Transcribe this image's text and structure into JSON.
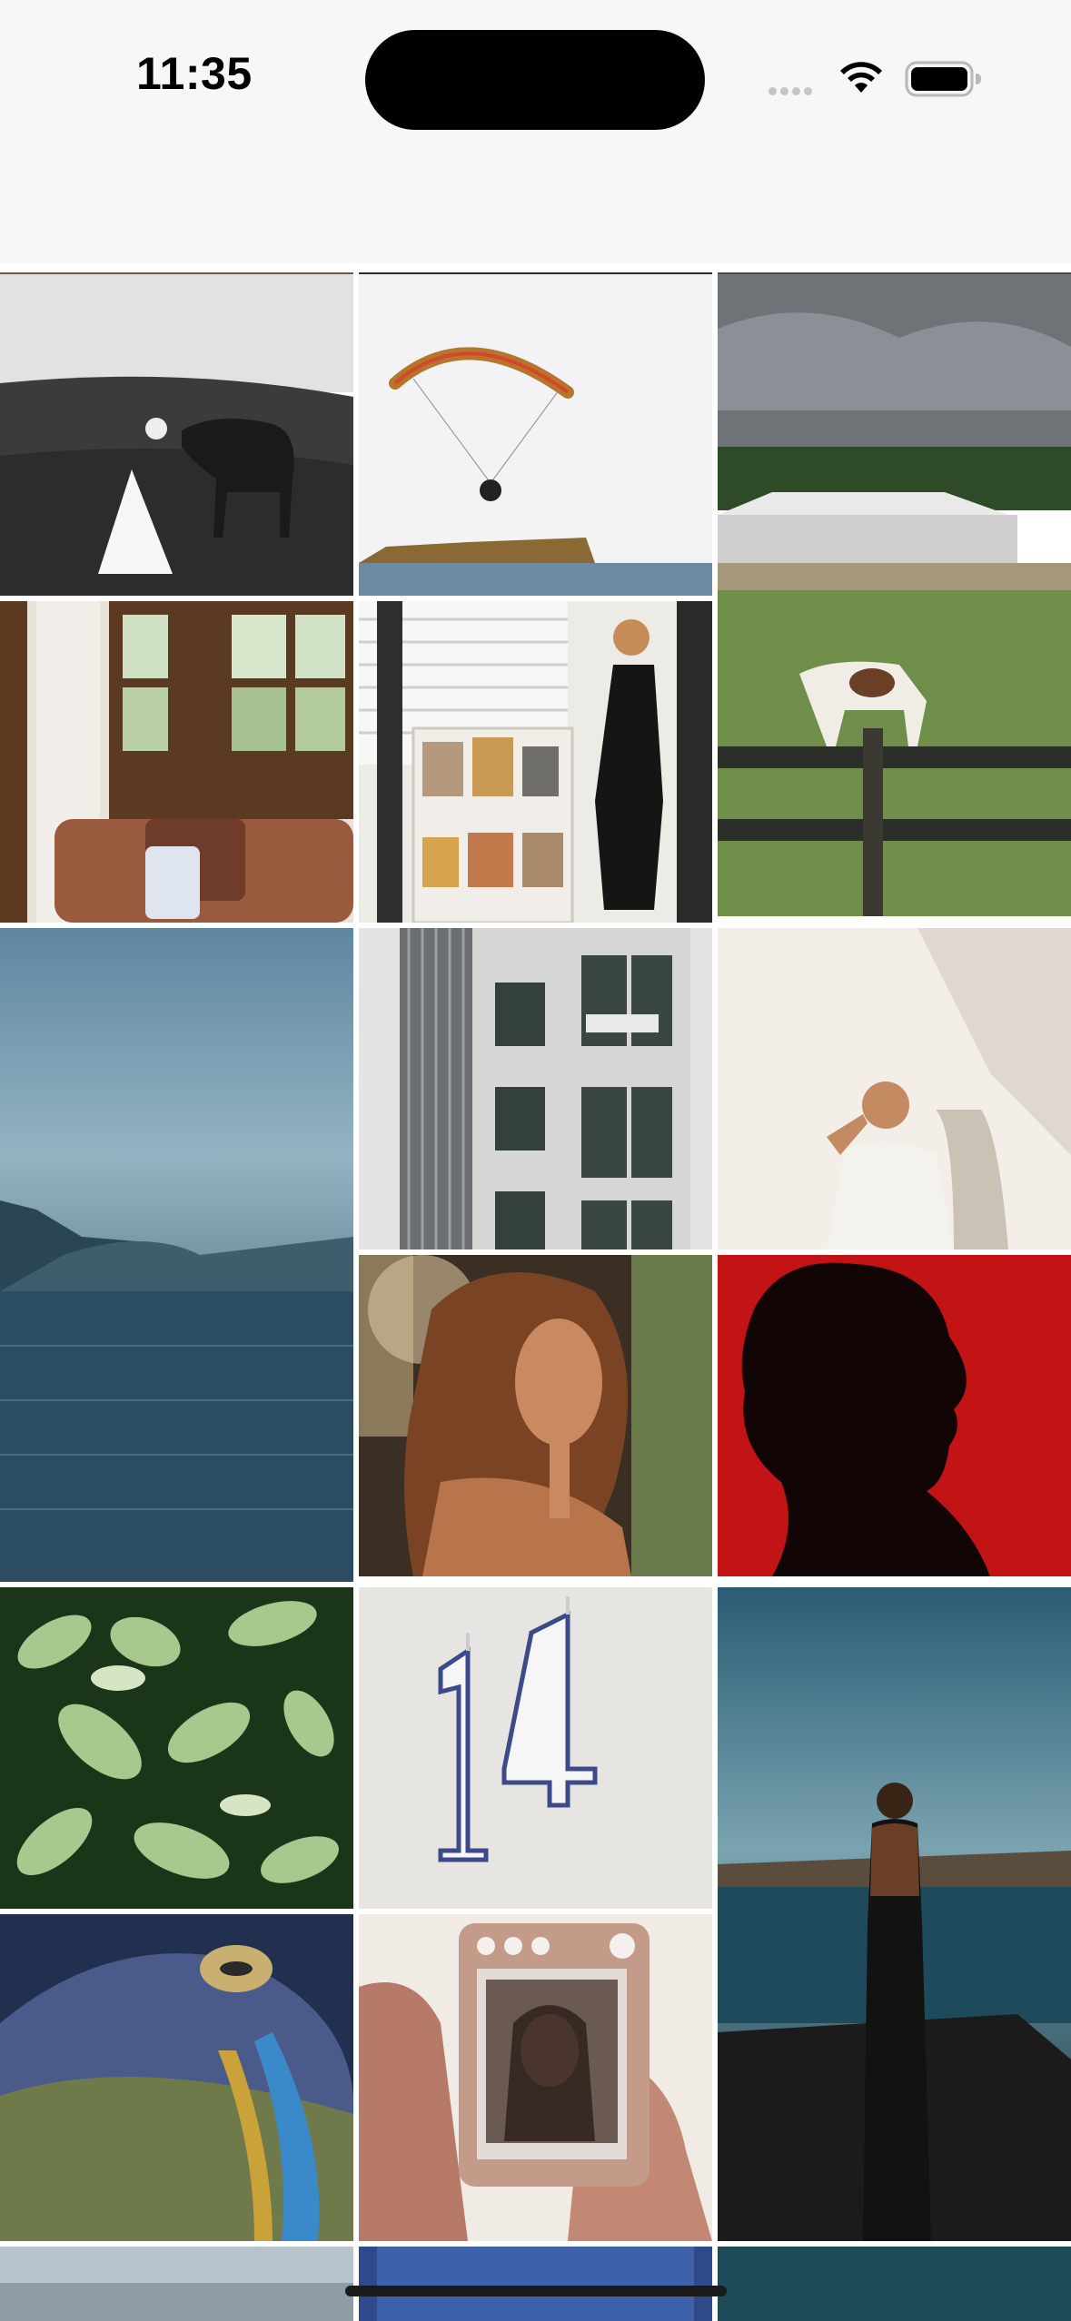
{
  "status_bar": {
    "time": "11:35",
    "icons": [
      "cellular-signal-icon",
      "wifi-icon",
      "battery-icon"
    ]
  },
  "gallery": {
    "columns": 3,
    "photos": [
      {
        "name": "photo-bride-with-horse",
        "colors": [
          "#e4e4e4",
          "#3a3a3a"
        ]
      },
      {
        "name": "photo-paraglider-over-sea",
        "colors": [
          "#f2f2f4",
          "#b5772e"
        ]
      },
      {
        "name": "photo-farm-with-horse",
        "colors": [
          "#6f7377",
          "#6b8a4a"
        ]
      },
      {
        "name": "photo-window-interior",
        "colors": [
          "#e9e3da",
          "#5a3a22"
        ]
      },
      {
        "name": "photo-woman-in-gallery",
        "colors": [
          "#efece6",
          "#1c1c1c"
        ]
      },
      {
        "name": "photo-misty-lake",
        "colors": [
          "#6b8fa6",
          "#1f3a4f"
        ]
      },
      {
        "name": "photo-office-building",
        "colors": [
          "#d9d9d9",
          "#5a5f62"
        ]
      },
      {
        "name": "photo-man-in-sunlight",
        "colors": [
          "#f4efe9",
          "#c99b7a"
        ]
      },
      {
        "name": "photo-woman-curly-hair",
        "colors": [
          "#4a3522",
          "#a8673b"
        ]
      },
      {
        "name": "photo-silhouette-red",
        "colors": [
          "#c41212",
          "#100505"
        ]
      },
      {
        "name": "photo-green-plant",
        "colors": [
          "#1c3818",
          "#b9d3a0"
        ]
      },
      {
        "name": "photo-number-candles",
        "colors": [
          "#e6e5e2",
          "#3d4a8a"
        ]
      },
      {
        "name": "photo-woman-by-water",
        "colors": [
          "#2d5f76",
          "#151515"
        ]
      },
      {
        "name": "photo-octopus-closeup",
        "colors": [
          "#2c3a5c",
          "#9b8b3c"
        ]
      },
      {
        "name": "photo-camera-in-hand",
        "colors": [
          "#f0e8e2",
          "#b3796b"
        ]
      }
    ]
  }
}
